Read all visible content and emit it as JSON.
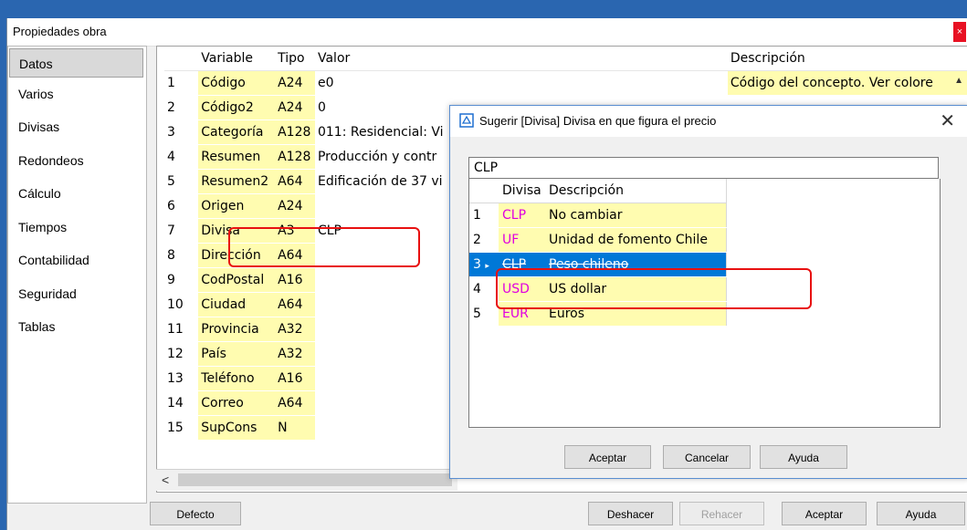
{
  "window": {
    "title": "Propiedades obra",
    "close_label": "×"
  },
  "sidebar": {
    "items": [
      {
        "label": "Datos",
        "active": true
      },
      {
        "label": "Varios"
      },
      {
        "label": "Divisas"
      },
      {
        "label": "Redondeos"
      },
      {
        "label": "Cálculo"
      },
      {
        "label": "Tiempos"
      },
      {
        "label": "Contabilidad"
      },
      {
        "label": "Seguridad"
      },
      {
        "label": "Tablas"
      }
    ]
  },
  "grid": {
    "columns": [
      "Variable",
      "Tipo",
      "Valor",
      "Descripción"
    ],
    "rows": [
      {
        "num": "1",
        "variable": "Código",
        "tipo": "A24",
        "valor": "e0",
        "descripcion": "Código del concepto. Ver colore"
      },
      {
        "num": "2",
        "variable": "Código2",
        "tipo": "A24",
        "valor": "0",
        "descripcion": ""
      },
      {
        "num": "3",
        "variable": "Categoría",
        "tipo": "A128",
        "valor": "011: Residencial: Vi",
        "descripcion": ""
      },
      {
        "num": "4",
        "variable": "Resumen",
        "tipo": "A128",
        "valor": "Producción y contr",
        "descripcion": ""
      },
      {
        "num": "5",
        "variable": "Resumen2",
        "tipo": "A64",
        "valor": "Edificación de 37 vi",
        "descripcion": ""
      },
      {
        "num": "6",
        "variable": "Origen",
        "tipo": "A24",
        "valor": "",
        "descripcion": ""
      },
      {
        "num": "7",
        "variable": "Divisa",
        "tipo": "A3",
        "valor": "CLP",
        "descripcion": ""
      },
      {
        "num": "8",
        "variable": "Dirección",
        "tipo": "A64",
        "valor": "",
        "descripcion": ""
      },
      {
        "num": "9",
        "variable": "CodPostal",
        "tipo": "A16",
        "valor": "",
        "descripcion": ""
      },
      {
        "num": "10",
        "variable": "Ciudad",
        "tipo": "A64",
        "valor": "",
        "descripcion": ""
      },
      {
        "num": "11",
        "variable": "Provincia",
        "tipo": "A32",
        "valor": "",
        "descripcion": ""
      },
      {
        "num": "12",
        "variable": "País",
        "tipo": "A32",
        "valor": "",
        "descripcion": ""
      },
      {
        "num": "13",
        "variable": "Teléfono",
        "tipo": "A16",
        "valor": "",
        "descripcion": ""
      },
      {
        "num": "14",
        "variable": "Correo",
        "tipo": "A64",
        "valor": "",
        "descripcion": ""
      },
      {
        "num": "15",
        "variable": "SupCons",
        "tipo": "N",
        "valor": "",
        "descripcion": ""
      }
    ]
  },
  "scroll": {
    "left_arrow": "<",
    "up_arrow": "▲"
  },
  "footer": {
    "defecto": "Defecto",
    "deshacer": "Deshacer",
    "rehacer": "Rehacer",
    "aceptar": "Aceptar",
    "ayuda": "Ayuda"
  },
  "dialog": {
    "title": "Sugerir [Divisa] Divisa en que figura el precio",
    "close_label": "✕",
    "search_value": "CLP",
    "columns": [
      "Divisa",
      "Descripción"
    ],
    "rows": [
      {
        "num": "1",
        "code": "CLP",
        "desc": "No cambiar"
      },
      {
        "num": "2",
        "code": "UF",
        "desc": "Unidad de fomento Chile"
      },
      {
        "num": "3",
        "code": "CLP",
        "desc": "Peso chileno",
        "selected": true
      },
      {
        "num": "4",
        "code": "USD",
        "desc": "US dollar"
      },
      {
        "num": "5",
        "code": "EUR",
        "desc": "Euros"
      }
    ],
    "buttons": {
      "aceptar": "Aceptar",
      "cancelar": "Cancelar",
      "ayuda": "Ayuda"
    }
  },
  "colors": {
    "cell_yellow": "#fffcb0",
    "code_magenta": "#e000e0",
    "selection_blue": "#0078d7",
    "annotation_red": "#e81010",
    "desktop_blue": "#2a66b0"
  }
}
